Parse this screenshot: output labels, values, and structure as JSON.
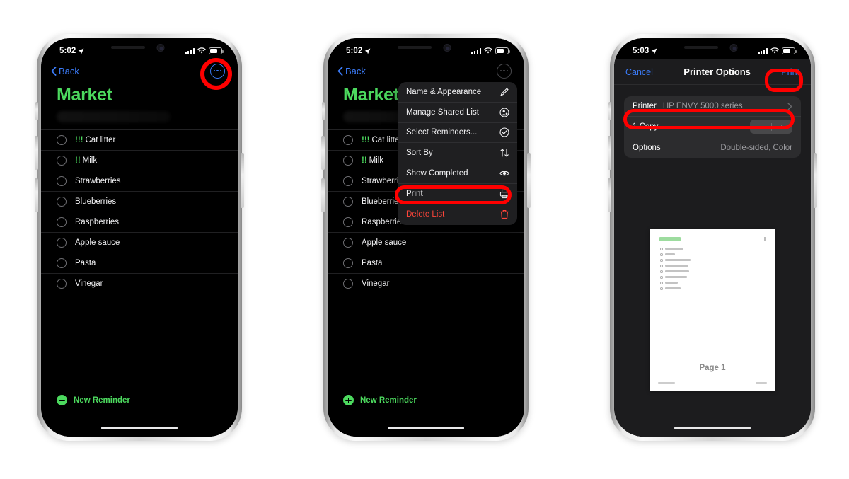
{
  "phones": [
    {
      "id": "phone-1",
      "status": {
        "time": "5:02",
        "location_icon": "location-arrow-icon",
        "signal_icon": "cellular-bars-icon",
        "wifi_icon": "wifi-icon",
        "battery_icon": "battery-icon"
      },
      "nav": {
        "back_label": "Back",
        "more_icon": "ellipsis-circle-icon"
      },
      "list": {
        "title": "Market",
        "title_color": "#4cd95e",
        "items": [
          {
            "priority": "!!!",
            "text": "Cat litter"
          },
          {
            "priority": "!!",
            "text": "Milk"
          },
          {
            "priority": "",
            "text": "Strawberries"
          },
          {
            "priority": "",
            "text": "Blueberries"
          },
          {
            "priority": "",
            "text": "Raspberries"
          },
          {
            "priority": "",
            "text": "Apple sauce"
          },
          {
            "priority": "",
            "text": "Pasta"
          },
          {
            "priority": "",
            "text": "Vinegar"
          }
        ]
      },
      "new_reminder_label": "New Reminder"
    },
    {
      "id": "phone-2",
      "status": {
        "time": "5:02"
      },
      "nav": {
        "back_label": "Back"
      },
      "list": {
        "title": "Market"
      },
      "menu": [
        {
          "label": "Name & Appearance",
          "icon": "pencil-icon",
          "destructive": false
        },
        {
          "label": "Manage Shared List",
          "icon": "shared-person-icon",
          "destructive": false
        },
        {
          "label": "Select Reminders...",
          "icon": "checkmark-circle-icon",
          "destructive": false
        },
        {
          "label": "Sort By",
          "icon": "sort-arrows-icon",
          "destructive": false
        },
        {
          "label": "Show Completed",
          "icon": "eye-icon",
          "destructive": false
        },
        {
          "label": "Print",
          "icon": "printer-icon",
          "destructive": false
        },
        {
          "label": "Delete List",
          "icon": "trash-icon",
          "destructive": true
        }
      ],
      "new_reminder_label": "New Reminder"
    },
    {
      "id": "phone-3",
      "status": {
        "time": "5:03"
      },
      "nav": {
        "cancel_label": "Cancel",
        "title": "Printer Options",
        "print_label": "Print"
      },
      "options": [
        {
          "label": "Printer",
          "value": "HP ENVY 5000 series",
          "accessory": "chevron-right-icon"
        },
        {
          "label": "1 Copy",
          "value": "",
          "accessory": "stepper"
        },
        {
          "label": "Options",
          "value": "Double-sided, Color",
          "accessory": "none"
        }
      ],
      "stepper": {
        "minus_label": "−",
        "plus_label": "+"
      },
      "preview": {
        "page_label": "Page 1"
      }
    }
  ],
  "annotations": {
    "highlight_color": "#ff0000",
    "targets": [
      "more-button-phone-1",
      "print-menu-item-phone-2",
      "printer-row-phone-3",
      "print-button-phone-3"
    ]
  }
}
